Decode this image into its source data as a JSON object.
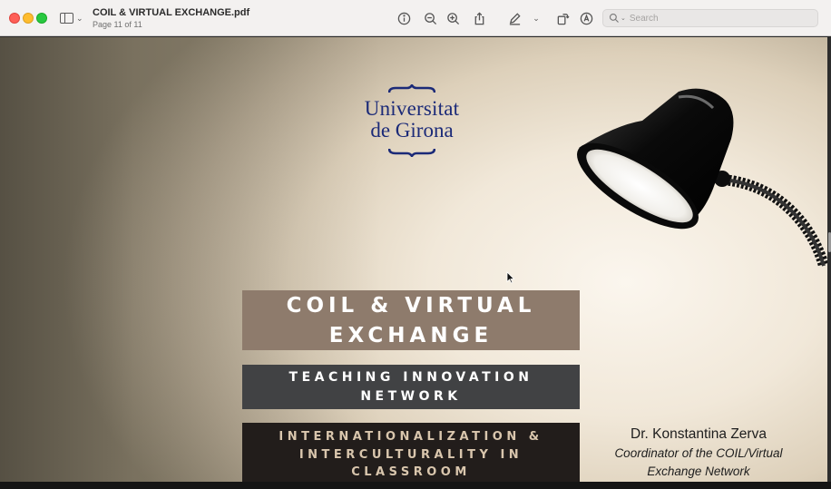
{
  "window": {
    "title": "COIL & VIRTUAL EXCHANGE.pdf",
    "page_indicator": "Page 11 of 11"
  },
  "toolbar": {
    "search_placeholder": "Search",
    "icons": [
      "sidebar-icon",
      "info-icon",
      "zoom-out-icon",
      "zoom-in-icon",
      "share-icon",
      "markup-pen-icon",
      "rotate-icon",
      "annotate-icon",
      "search-icon"
    ]
  },
  "slide": {
    "logo": {
      "line1": "Universitat",
      "line2": "de Girona",
      "color": "#1b2a78"
    },
    "banner1": {
      "line1": "COIL & VIRTUAL",
      "line2": "EXCHANGE",
      "color": "#8e7b6c"
    },
    "banner2": {
      "line1": "TEACHING INNOVATION",
      "line2": "NETWORK",
      "color": "#414244"
    },
    "banner3": {
      "line1": "INTERNATIONALIZATION &",
      "line2": "INTERCULTURALITY IN",
      "line3": "CLASSROOM",
      "color": "#221d1b"
    },
    "author": {
      "name": "Dr. Konstantina Zerva",
      "role_line1": "Coordinator of the COIL/Virtual",
      "role_line2": "Exchange Network"
    }
  }
}
